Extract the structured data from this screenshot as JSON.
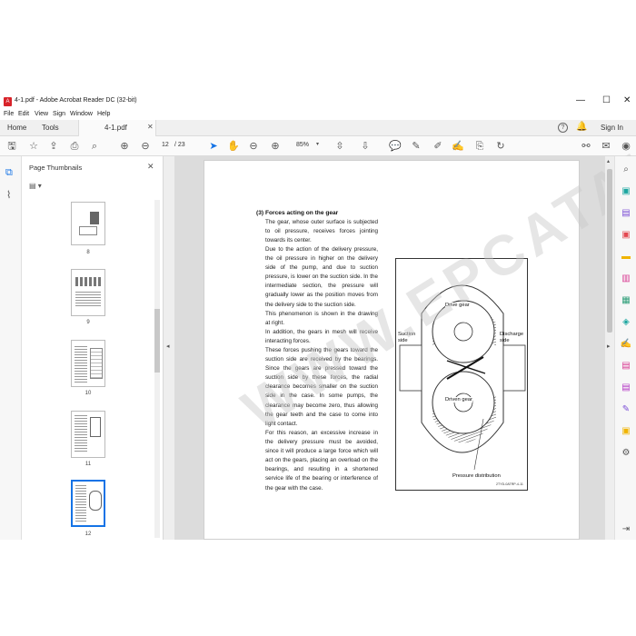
{
  "window": {
    "title": "4-1.pdf - Adobe Acrobat Reader DC (32-bit)",
    "menu": [
      "File",
      "Edit",
      "View",
      "Sign",
      "Window",
      "Help"
    ],
    "nav_tabs": [
      "Home",
      "Tools"
    ],
    "doc_tab": "4-1.pdf",
    "sign_in": "Sign In"
  },
  "toolbar": {
    "page_current": "12",
    "page_total": "/ 23",
    "zoom": "85%"
  },
  "thumbnails": {
    "title": "Page Thumbnails",
    "pages": [
      "8",
      "9",
      "10",
      "11",
      "12"
    ]
  },
  "page": {
    "heading": "Forces acting on the gear",
    "heading_num": "(3)",
    "paragraphs": [
      "The gear, whose outer surface is subjected to oil pressure, receives forces jointing towards its center.",
      "Due to the action of the delivery pressure, the oil pressure in higher on the delivery side of the pump, and due to suction pressure, is lower on the suction side. In the intermediate section, the pressure will gradually lower as the position moves from the delivery side to the suction side.",
      "This phenomenon is shown in the drawing at right.",
      "In addition, the gears in mesh will receive interacting forces.",
      "These forces pushing the gears toward the suction side are received by the bearings. Since the gears are pressed toward the suction side by these forces, the radial clearance becomes smaller on the suction side in the case. In some pumps, the clearance may become zero, thus allowing the gear teeth and the case to come into light contact.",
      "For this reason, an excessive increase in the delivery pressure must be avoided, since it will produce a large force which will act on the gears, placing an overload on the bearings, and resulting in a shortened service life of the bearing or interference of the gear with the case."
    ],
    "figure": {
      "drive_gear": "Drive gear",
      "driven_gear": "Driven gear",
      "suction_side": "Suction side",
      "discharge_side": "Discharge side",
      "pressure_distribution": "Pressure distribution",
      "code": "2TYD-0ATRP-4-11"
    },
    "watermark": "WWW.EPCATALOG.COM"
  },
  "colors": {
    "accent": "#1473e6",
    "panel_bg": "#f7f7f7",
    "doc_bg": "#dcdcdc"
  }
}
